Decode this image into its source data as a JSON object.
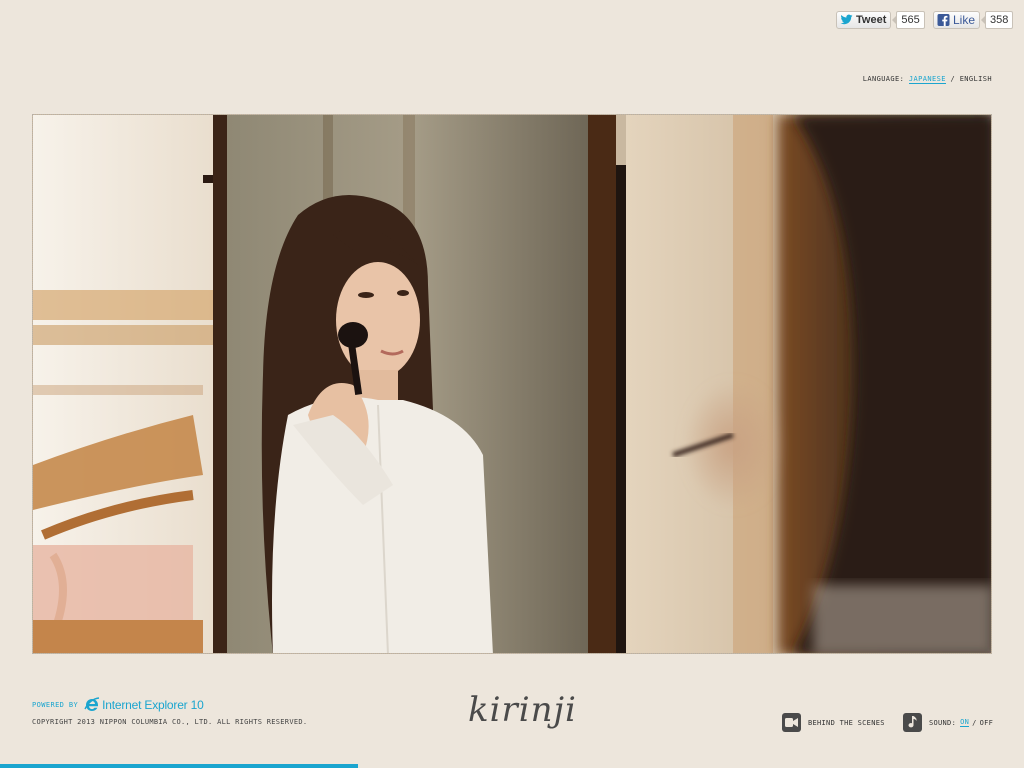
{
  "social": {
    "tweet_label": "Tweet",
    "tweet_count": "565",
    "like_label": "Like",
    "like_count": "358"
  },
  "language": {
    "label": "LANGUAGE:",
    "options": [
      "JAPANESE",
      "ENGLISH"
    ],
    "active": "JAPANESE",
    "separator": "/"
  },
  "video": {
    "icon": "video-frame"
  },
  "footer": {
    "powered_by": "POWERED BY",
    "browser_name": "Internet Explorer 10",
    "copyright": "COPYRIGHT 2013 NIPPON COLUMBIA CO., LTD. ALL RIGHTS RESERVED.",
    "logo_text": "kirinji",
    "behind_scenes": "BEHIND THE SCENES",
    "sound_label": "SOUND:",
    "sound_on": "ON",
    "sound_off": "OFF",
    "sound_separator": "/"
  },
  "progress": {
    "fraction": 0.35
  },
  "colors": {
    "accent": "#1ba5cf",
    "background": "#ede6dc",
    "icon_dark": "#4a4a4a"
  }
}
